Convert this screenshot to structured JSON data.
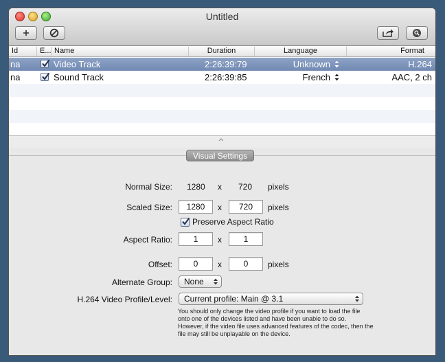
{
  "window": {
    "title": "Untitled"
  },
  "toolbar": {
    "add_icon": "plus-icon",
    "remove_icon": "prohibited-icon",
    "share_icon": "share-icon",
    "inspect_icon": "magnifier-icon"
  },
  "table": {
    "columns": [
      "Id",
      "E...",
      "Name",
      "Duration",
      "Language",
      "Format"
    ],
    "rows": [
      {
        "id": "na",
        "enabled": true,
        "name": "Video Track",
        "duration": "2:26:39:79",
        "language": "Unknown",
        "format": "H.264"
      },
      {
        "id": "na",
        "enabled": true,
        "name": "Sound Track",
        "duration": "2:26:39:85",
        "language": "French",
        "format": "AAC, 2 ch"
      }
    ]
  },
  "settings": {
    "tab_label": "Visual Settings",
    "normal_size": {
      "label": "Normal Size:",
      "width": "1280",
      "x": "x",
      "height": "720",
      "unit": "pixels"
    },
    "scaled_size": {
      "label": "Scaled Size:",
      "width": "1280",
      "x": "x",
      "height": "720",
      "unit": "pixels"
    },
    "preserve_aspect": {
      "label": "Preserve Aspect Ratio",
      "checked": true
    },
    "aspect_ratio": {
      "label": "Aspect Ratio:",
      "a": "1",
      "x": "x",
      "b": "1"
    },
    "offset": {
      "label": "Offset:",
      "a": "0",
      "x": "x",
      "b": "0",
      "unit": "pixels"
    },
    "alternate_group": {
      "label": "Alternate Group:",
      "value": "None"
    },
    "profile": {
      "label": "H.264 Video Profile/Level:",
      "value": "Current profile: Main @ 3.1"
    },
    "note": "You should only change the video profile if you want to load the file onto one of the devices listed and have been unable to do so.  However, if the video file uses advanced features of the codec, then the file may still be unplayable on the device."
  },
  "colors": {
    "selection": "#7d94bc",
    "desktop": "#3a5a7a"
  }
}
